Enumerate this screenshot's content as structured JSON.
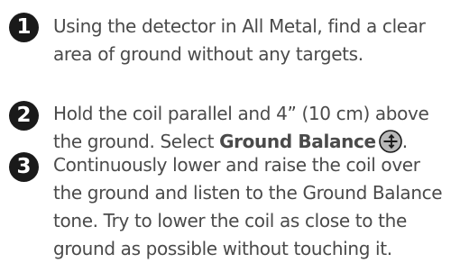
{
  "steps": [
    {
      "number": "1",
      "lines": [
        "Using the detector in All Metal, find a clear",
        "area of ground without any targets."
      ]
    },
    {
      "number": "2",
      "line1": "Hold the coil parallel and 4” (10 cm) above",
      "line2_prefix": "the ground. Select ",
      "line2_bold": "Ground Balance",
      "line2_suffix": ".",
      "icon": "ground-balance-icon"
    },
    {
      "number": "3",
      "lines": [
        "Continuously lower and raise the coil over",
        "the ground and listen to the Ground Balance",
        "tone. Try to lower the coil as close to the",
        "ground as possible without touching it."
      ]
    }
  ]
}
